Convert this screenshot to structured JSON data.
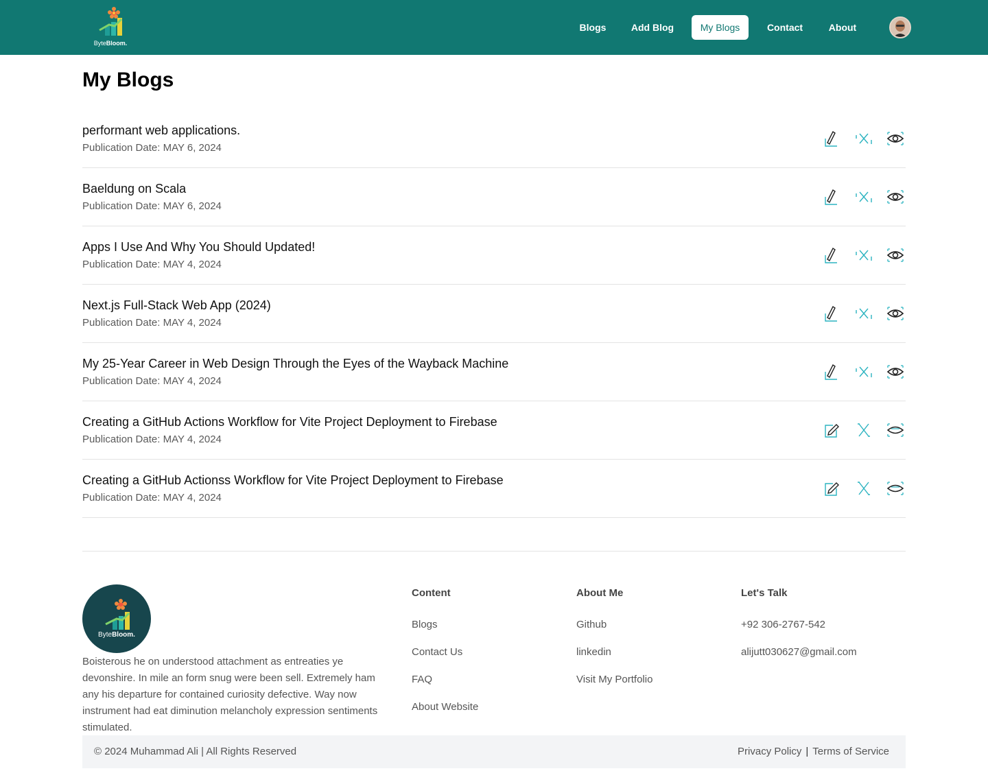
{
  "brand": {
    "name_plain": "Byte",
    "name_bold": "Bloom."
  },
  "colors": {
    "header_bg": "#117872",
    "accent": "#117872",
    "icon_teal": "#2bb3c0",
    "footer_logo_bg": "#17464d"
  },
  "nav": {
    "items": [
      {
        "label": "Blogs"
      },
      {
        "label": "Add Blog"
      },
      {
        "label": "My Blogs"
      },
      {
        "label": "Contact"
      },
      {
        "label": "About"
      }
    ],
    "active": "My Blogs"
  },
  "page": {
    "title": "My Blogs"
  },
  "blogs": [
    {
      "title": "performant web applications.",
      "date": "Publication Date: MAY 6, 2024"
    },
    {
      "title": "Baeldung on Scala",
      "date": "Publication Date: MAY 6, 2024"
    },
    {
      "title": "Apps I Use And Why You Should Updated!",
      "date": "Publication Date: MAY 4, 2024"
    },
    {
      "title": "Next.js Full-Stack Web App (2024)",
      "date": "Publication Date: MAY 4, 2024"
    },
    {
      "title": "My 25-Year Career in Web Design Through the Eyes of the Wayback Machine",
      "date": "Publication Date: MAY 4, 2024"
    },
    {
      "title": "Creating a GitHub Actions Workflow for Vite Project Deployment to Firebase",
      "date": "Publication Date: MAY 4, 2024"
    },
    {
      "title": "Creating a GitHub Actionss Workflow for Vite Project Deployment to Firebase",
      "date": "Publication Date: MAY 4, 2024"
    }
  ],
  "row_actions": {
    "icons": [
      "pencil-edit-icon",
      "x-delete-icon",
      "eye-view-icon"
    ]
  },
  "footer": {
    "description": "Boisterous he on understood attachment as entreaties ye devonshire. In mile an form snug were been sell. Extremely ham any his departure for contained curiosity defective. Way now instrument had eat diminution melancholy expression sentiments stimulated.",
    "columns": [
      {
        "title": "Content",
        "links": [
          "Blogs",
          "Contact Us",
          "FAQ",
          "About Website"
        ]
      },
      {
        "title": "About Me",
        "links": [
          "Github",
          "linkedin",
          "Visit My Portfolio"
        ]
      },
      {
        "title": "Let's Talk",
        "links": [
          "+92 306-2767-542",
          "alijutt030627@gmail.com"
        ]
      }
    ],
    "copyright": "© 2024 Muhammad Ali | All Rights Reserved",
    "legal": {
      "privacy": "Privacy Policy",
      "separator": "|",
      "terms": "Terms of Service"
    }
  }
}
